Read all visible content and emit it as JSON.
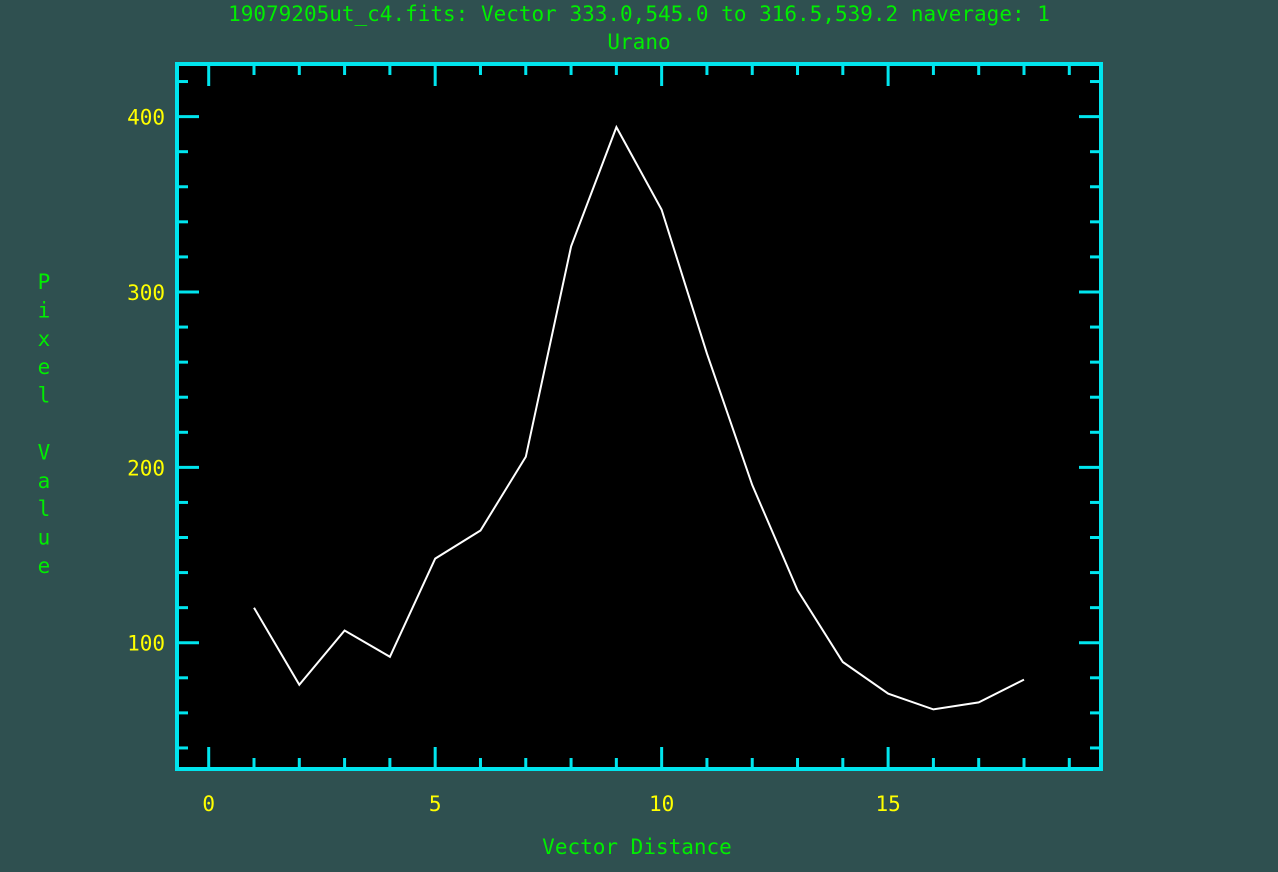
{
  "title": "19079205ut_c4.fits: Vector 333.0,545.0 to 316.5,539.2 naverage: 1",
  "subtitle": "Urano",
  "colors": {
    "background": "#2f5050",
    "plot_area": "#000000",
    "frame": "#00e5ee",
    "title_text": "#00ee00",
    "tick_labels": "#ffff00",
    "series_line": "#ffffff"
  },
  "chart_data": {
    "type": "line",
    "title": "19079205ut_c4.fits: Vector 333.0,545.0 to 316.5,539.2 naverage: 1",
    "subtitle": "Urano",
    "xlabel": "Vector Distance",
    "ylabel": "Pixel Value",
    "xlim": [
      -0.7,
      19.7
    ],
    "ylim": [
      28,
      430
    ],
    "x_ticks": [
      0,
      5,
      10,
      15
    ],
    "x_tick_labels": [
      "0",
      "5",
      "10",
      "15"
    ],
    "y_ticks": [
      100,
      200,
      300,
      400
    ],
    "y_tick_labels": [
      "100",
      "200",
      "300",
      "400"
    ],
    "grid": false,
    "legend": "none",
    "series": [
      {
        "x": [
          1,
          2,
          3,
          4,
          5,
          6,
          7,
          8,
          9,
          10,
          11,
          12,
          13,
          14,
          15,
          16,
          17,
          18
        ],
        "y": [
          120,
          76,
          107,
          92,
          148,
          164,
          206,
          326,
          394,
          347,
          265,
          190,
          130,
          89,
          71,
          62,
          66,
          79
        ]
      }
    ]
  }
}
